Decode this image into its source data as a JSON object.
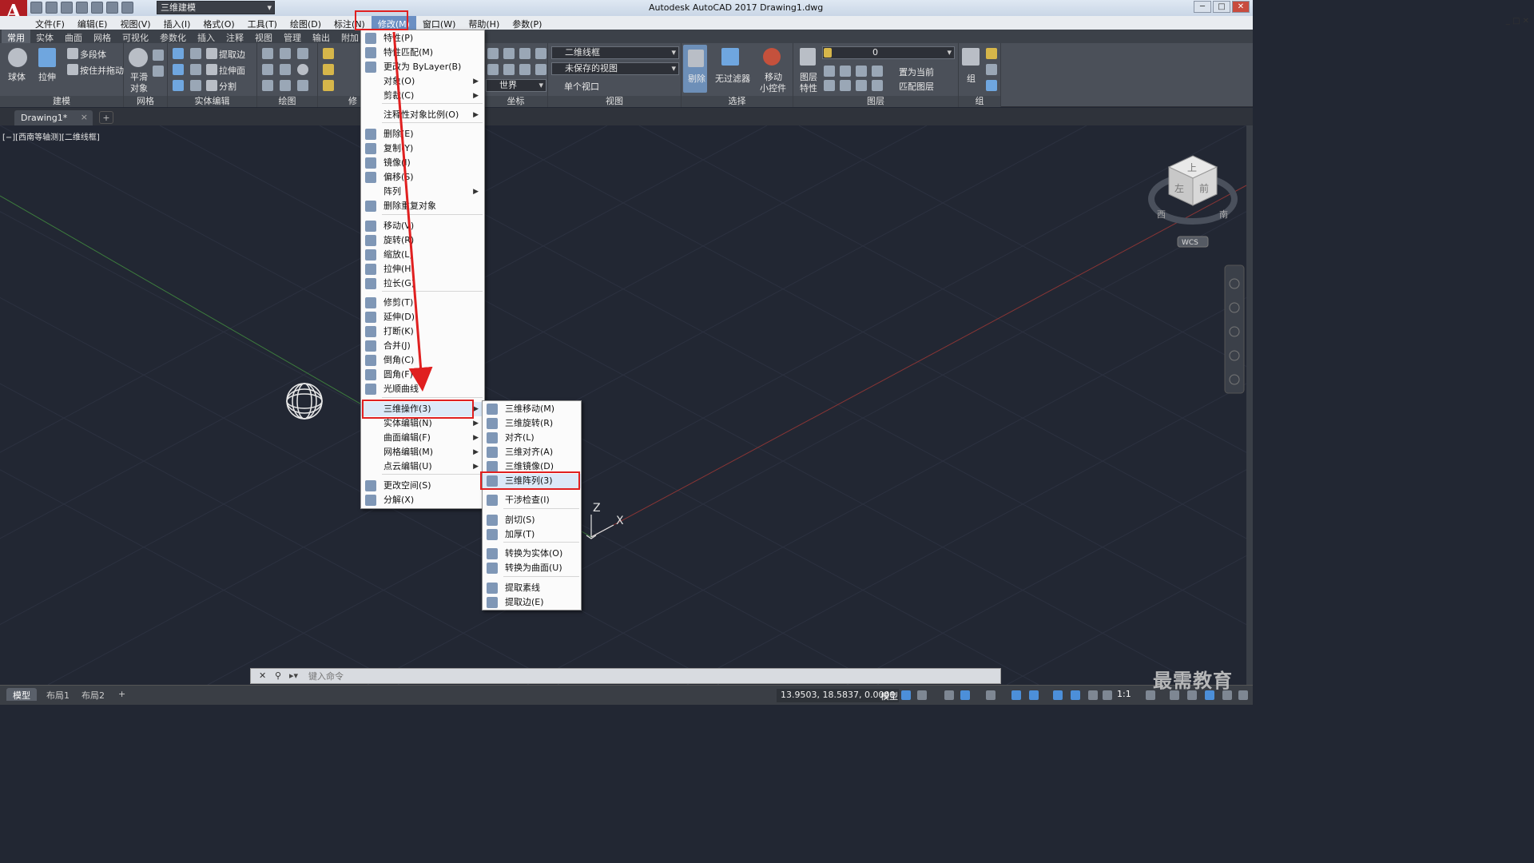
{
  "app": {
    "logo": "A",
    "title": "Autodesk AutoCAD 2017    Drawing1.dwg",
    "workspace": "三维建模",
    "window_buttons": [
      "─",
      "□",
      "✕"
    ],
    "doc_window_controls": "_ □ ✕"
  },
  "menubar": {
    "items": [
      "文件(F)",
      "编辑(E)",
      "视图(V)",
      "插入(I)",
      "格式(O)",
      "工具(T)",
      "绘图(D)",
      "标注(N)",
      "修改(M)",
      "窗口(W)",
      "帮助(H)",
      "参数(P)"
    ],
    "active": "修改(M)"
  },
  "ribbon_tabs": [
    "常用",
    "实体",
    "曲面",
    "网格",
    "可视化",
    "参数化",
    "插入",
    "注释",
    "视图",
    "管理",
    "输出",
    "附加"
  ],
  "ribbon": {
    "modeling": {
      "title": "建模",
      "sphere": "球体",
      "extrude": "拉伸",
      "polysolid": "多段体",
      "presspull": "按住并拖动"
    },
    "mesh": {
      "title": "网格",
      "smooth": "平滑",
      "object": "对象"
    },
    "solid_edit": {
      "title": "实体编辑",
      "extract_edges": "提取边",
      "extrude_faces": "拉伸面",
      "separate": "分割"
    },
    "draw": {
      "title": "绘图"
    },
    "modify_short": {
      "title": "修"
    },
    "coords": {
      "title": "坐标",
      "world": "世界"
    },
    "view": {
      "title": "视图",
      "visual_style": "二维线框",
      "saved_view": "未保存的视图",
      "viewport": "单个视口"
    },
    "selection": {
      "title": "选择",
      "cull": "剔除",
      "no_filter": "无过滤器",
      "gizmo": "移动",
      "gizmo2": "小控件"
    },
    "layers": {
      "title": "图层",
      "layer_props": "图层",
      "layer_props2": "特性",
      "layer_name": "0",
      "set_current": "置为当前",
      "match_layer": "匹配图层"
    },
    "groups": {
      "title": "组",
      "group": "组"
    }
  },
  "doc_tab": {
    "name": "Drawing1*",
    "close": "×",
    "new": "+"
  },
  "viewport": {
    "label": "[−][西南等轴测][二维线框]",
    "viewcube": {
      "top": "上",
      "left": "左",
      "front": "前",
      "west": "西",
      "south": "南",
      "wcs": "WCS"
    },
    "ucs": {
      "z": "Z",
      "x": "X"
    }
  },
  "modify_menu": {
    "items": [
      {
        "label": "特性(P)",
        "icon": "properties-icon",
        "submenu": false
      },
      {
        "label": "特性匹配(M)",
        "icon": "match-properties-icon",
        "submenu": false
      },
      {
        "label": "更改为 ByLayer(B)",
        "icon": "bylayer-icon",
        "submenu": false
      },
      {
        "label": "对象(O)",
        "icon": "",
        "submenu": true
      },
      {
        "label": "剪裁(C)",
        "icon": "",
        "submenu": true
      },
      {
        "label": "注释性对象比例(O)",
        "icon": "",
        "submenu": true
      },
      {
        "label": "删除(E)",
        "icon": "erase-icon",
        "submenu": false
      },
      {
        "label": "复制(Y)",
        "icon": "copy-icon",
        "submenu": false
      },
      {
        "label": "镜像(I)",
        "icon": "mirror-icon",
        "submenu": false
      },
      {
        "label": "偏移(S)",
        "icon": "offset-icon",
        "submenu": false
      },
      {
        "label": "阵列",
        "icon": "",
        "submenu": true
      },
      {
        "label": "删除重复对象",
        "icon": "delete-duplicates-icon",
        "submenu": false
      },
      {
        "label": "移动(V)",
        "icon": "move-icon",
        "submenu": false
      },
      {
        "label": "旋转(R)",
        "icon": "rotate-icon",
        "submenu": false
      },
      {
        "label": "缩放(L)",
        "icon": "scale-icon",
        "submenu": false
      },
      {
        "label": "拉伸(H)",
        "icon": "stretch-icon",
        "submenu": false
      },
      {
        "label": "拉长(G)",
        "icon": "lengthen-icon",
        "submenu": false
      },
      {
        "label": "修剪(T)",
        "icon": "trim-icon",
        "submenu": false
      },
      {
        "label": "延伸(D)",
        "icon": "extend-icon",
        "submenu": false
      },
      {
        "label": "打断(K)",
        "icon": "break-icon",
        "submenu": false
      },
      {
        "label": "合并(J)",
        "icon": "join-icon",
        "submenu": false
      },
      {
        "label": "倒角(C)",
        "icon": "chamfer-icon",
        "submenu": false
      },
      {
        "label": "圆角(F)",
        "icon": "fillet-icon",
        "submenu": false
      },
      {
        "label": "光顺曲线",
        "icon": "blend-curves-icon",
        "submenu": false
      },
      {
        "label": "三维操作(3)",
        "icon": "",
        "submenu": true
      },
      {
        "label": "实体编辑(N)",
        "icon": "",
        "submenu": true
      },
      {
        "label": "曲面编辑(F)",
        "icon": "",
        "submenu": true
      },
      {
        "label": "网格编辑(M)",
        "icon": "",
        "submenu": true
      },
      {
        "label": "点云编辑(U)",
        "icon": "",
        "submenu": true
      },
      {
        "label": "更改空间(S)",
        "icon": "change-space-icon",
        "submenu": false
      },
      {
        "label": "分解(X)",
        "icon": "explode-icon",
        "submenu": false
      }
    ]
  },
  "ops3d_menu": {
    "items": [
      {
        "label": "三维移动(M)",
        "icon": "3dmove-icon"
      },
      {
        "label": "三维旋转(R)",
        "icon": "3drotate-icon"
      },
      {
        "label": "对齐(L)",
        "icon": "align-icon"
      },
      {
        "label": "三维对齐(A)",
        "icon": "3dalign-icon"
      },
      {
        "label": "三维镜像(D)",
        "icon": "3dmirror-icon"
      },
      {
        "label": "三维阵列(3)",
        "icon": "3darray-icon"
      },
      {
        "label": "干涉检查(I)",
        "icon": "interference-icon"
      },
      {
        "label": "剖切(S)",
        "icon": "slice-icon"
      },
      {
        "label": "加厚(T)",
        "icon": "thicken-icon"
      },
      {
        "label": "转换为实体(O)",
        "icon": "convert-solid-icon"
      },
      {
        "label": "转换为曲面(U)",
        "icon": "convert-surface-icon"
      },
      {
        "label": "提取素线",
        "icon": "extract-isolines-icon"
      },
      {
        "label": "提取边(E)",
        "icon": "extract-edges-icon"
      }
    ]
  },
  "command_line": {
    "placeholder": "键入命令",
    "close": "✕"
  },
  "statusbar": {
    "layouts": [
      "模型",
      "布局1",
      "布局2"
    ],
    "new_layout": "+",
    "coords": "13.9503, 18.5837, 0.0000",
    "model": "模型",
    "scale": "1:1"
  },
  "watermark": "最需教育",
  "colors": {
    "highlight": "#e02020",
    "menu_active": "#6b8fc3",
    "logo": "#b01e23"
  }
}
